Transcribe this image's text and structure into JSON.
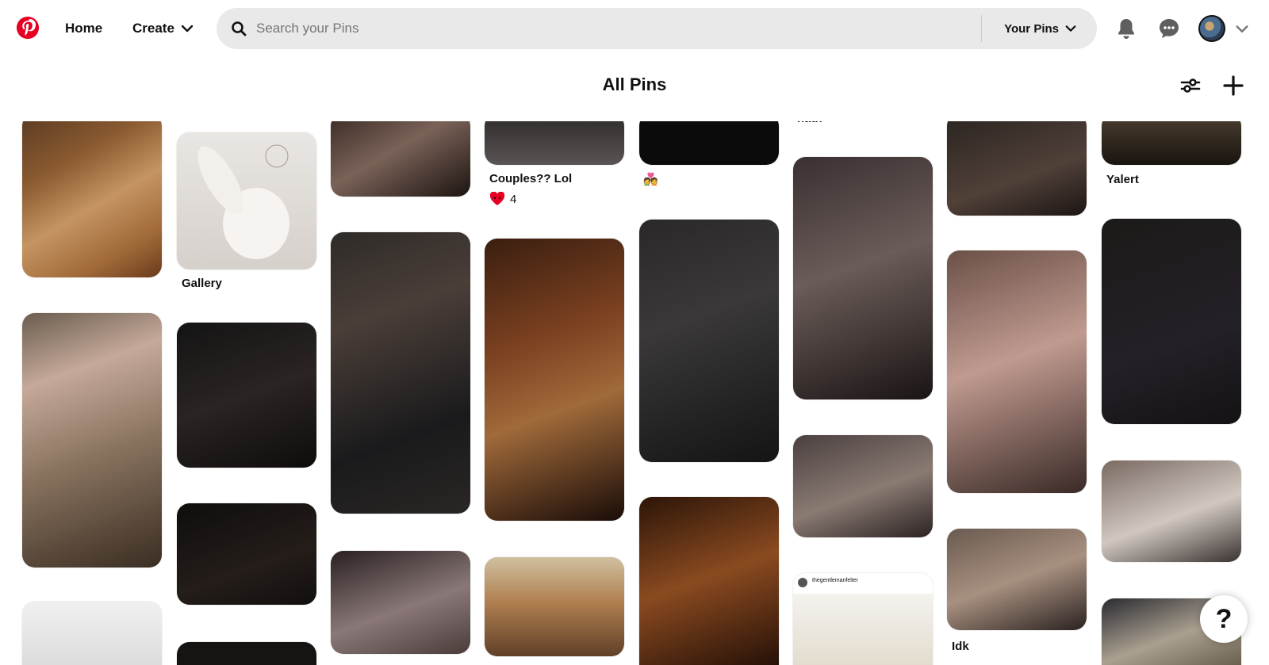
{
  "header": {
    "logo_icon": "pinterest-logo-icon",
    "brand_color": "#E60023",
    "nav": {
      "home": "Home",
      "create": "Create"
    },
    "search": {
      "placeholder": "Search your Pins",
      "scope": "Your Pins"
    },
    "icons": [
      "bell-icon",
      "chat-icon",
      "avatar",
      "chevron-down-icon"
    ]
  },
  "board": {
    "title": "All Pins",
    "tools": [
      "filter-icon",
      "plus-icon"
    ]
  },
  "pins": [
    {
      "title": "",
      "colors": [
        "#8a5a30",
        "#b88852",
        "#4a2c18"
      ]
    },
    {
      "title": "",
      "colors": [
        "#222",
        "#1a1a1a"
      ]
    },
    {
      "title": "",
      "colors": [
        "#6c5d4e",
        "#c5a99a",
        "#3a2d22"
      ]
    },
    {
      "title": "Gallery",
      "colors": [
        "#e8e6e4",
        "#c9c3be"
      ]
    },
    {
      "title": "",
      "colors": [
        "#141414",
        "#2a2422"
      ]
    },
    {
      "title": "",
      "colors": [
        "#0f0d0c",
        "#241d1a"
      ]
    },
    {
      "title": "",
      "colors": [
        "#3a2a24",
        "#7a6258",
        "#1c1410"
      ]
    },
    {
      "title": "",
      "colors": [
        "#2e2b28",
        "#1a1a1c",
        "#6a5a52"
      ]
    },
    {
      "title": "",
      "colors": [
        "#2a2020",
        "#8a7878"
      ]
    },
    {
      "title": "Couples?? Lol",
      "colors": [
        "#4a4646",
        "#2e2a28"
      ],
      "reaction_count": "4"
    },
    {
      "title": "",
      "colors": [
        "#3a1e10",
        "#a06a3a",
        "#1a0c08"
      ]
    },
    {
      "title": "",
      "colors": [
        "#b08050",
        "#604028",
        "#d0c0a0"
      ]
    },
    {
      "title": "",
      "colors": [
        "#0b0b0b"
      ],
      "emoji": "💑"
    },
    {
      "title": "",
      "colors": [
        "#2a2828",
        "#3a3838",
        "#141414"
      ]
    },
    {
      "title": "",
      "colors": [
        "#2c1508",
        "#8a4a20",
        "#1a0a04"
      ]
    },
    {
      "title": "hath",
      "colors": []
    },
    {
      "title": "",
      "colors": [
        "#3a3032",
        "#6a5c58",
        "#1a1414"
      ]
    },
    {
      "title": "",
      "colors": [
        "#4a4040",
        "#8a7a72",
        "#2a2222"
      ]
    },
    {
      "title": "",
      "colors": [
        "#ffffff",
        "#f2efe8"
      ],
      "source_handle": "thegentlemanfelter"
    },
    {
      "title": "",
      "colors": [
        "#2a2420",
        "#504038"
      ]
    },
    {
      "title": "",
      "colors": [
        "#6a5048",
        "#c09a90",
        "#3a2a26"
      ]
    },
    {
      "title": "Idk",
      "colors": [
        "#6a5a50",
        "#a89080",
        "#2a2220"
      ]
    },
    {
      "title": "Yalert",
      "colors": [
        "#4a4030",
        "#1a1410"
      ]
    },
    {
      "title": "",
      "colors": [
        "#1c1a18",
        "#141214"
      ]
    },
    {
      "title": "",
      "colors": [
        "#7a6a62",
        "#d0c8c0",
        "#3a3230"
      ]
    },
    {
      "title": "",
      "colors": [
        "#2a2a30",
        "#aaa090",
        "#5a5040"
      ]
    }
  ],
  "help": {
    "label": "?"
  }
}
